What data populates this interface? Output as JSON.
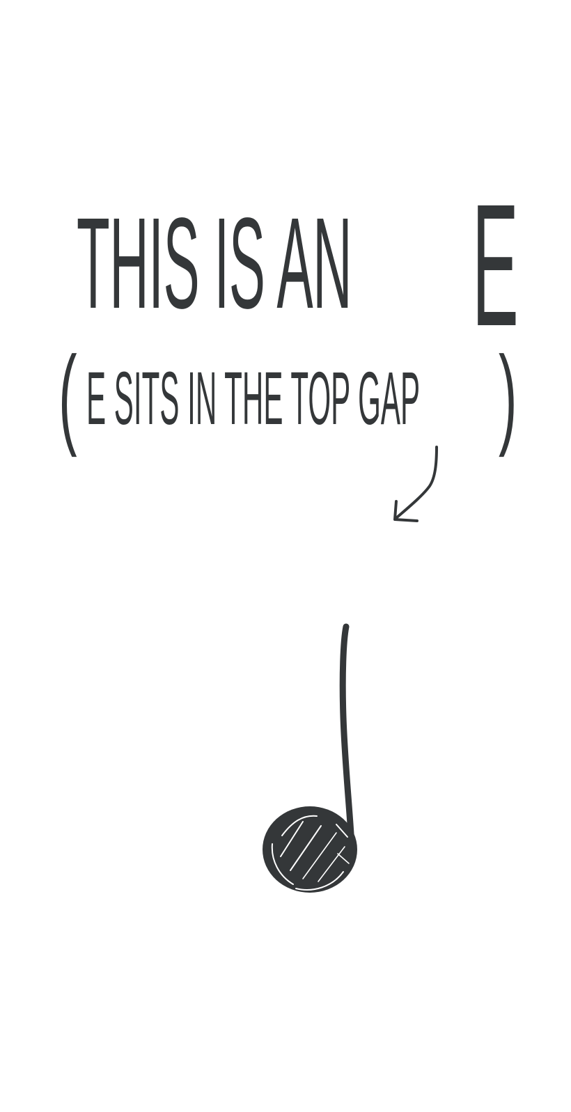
{
  "headline": {
    "text": "THIS IS AN",
    "letter": "E"
  },
  "subline": {
    "open_paren": "(",
    "text": "E SITS IN THE TOP GAP",
    "close_paren": ")"
  },
  "icons": {
    "arrow": "curved-arrow-icon",
    "note": "musical-note-icon"
  },
  "colors": {
    "ink": "#343739",
    "background": "#ffffff"
  }
}
